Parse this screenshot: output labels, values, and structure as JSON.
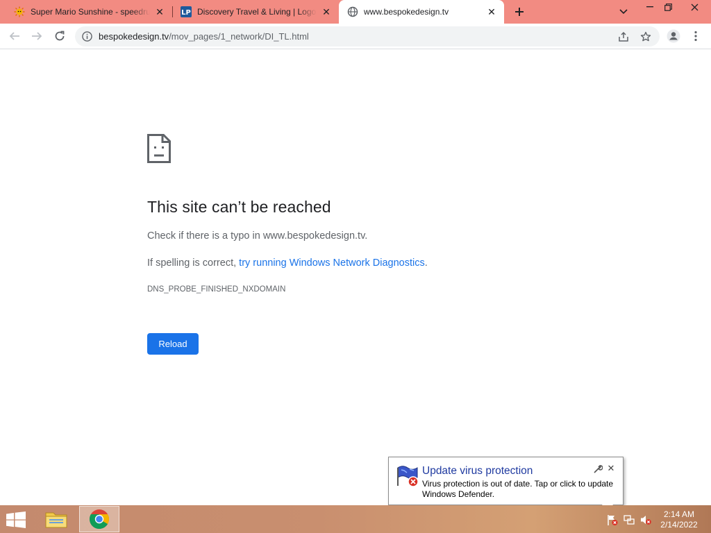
{
  "tabs": [
    {
      "title": "Super Mario Sunshine - speedrun",
      "favicon": "shine-sprite-icon"
    },
    {
      "title": "Discovery Travel & Living | Logopedia",
      "favicon": "lp-logo-icon"
    },
    {
      "title": "www.bespokedesign.tv",
      "favicon": "globe-icon"
    }
  ],
  "toolbar": {
    "url_domain": "bespokedesign.tv",
    "url_path": "/mov_pages/1_network/DI_TL.html"
  },
  "error": {
    "heading": "This site can’t be reached",
    "line1": "Check if there is a typo in www.bespokedesign.tv.",
    "line2_prefix": "If spelling is correct, ",
    "line2_link": "try running Windows Network Diagnostics",
    "line2_suffix": ".",
    "code": "DNS_PROBE_FINISHED_NXDOMAIN",
    "reload_label": "Reload"
  },
  "notification": {
    "title": "Update virus protection",
    "text": "Virus protection is out of date. Tap or click to update Windows Defender."
  },
  "clock": {
    "time": "2:14 AM",
    "date": "2/14/2022"
  },
  "colors": {
    "tabstrip": "#f28b82",
    "accent": "#1a73e8",
    "notification_title": "#1f3aa0"
  }
}
